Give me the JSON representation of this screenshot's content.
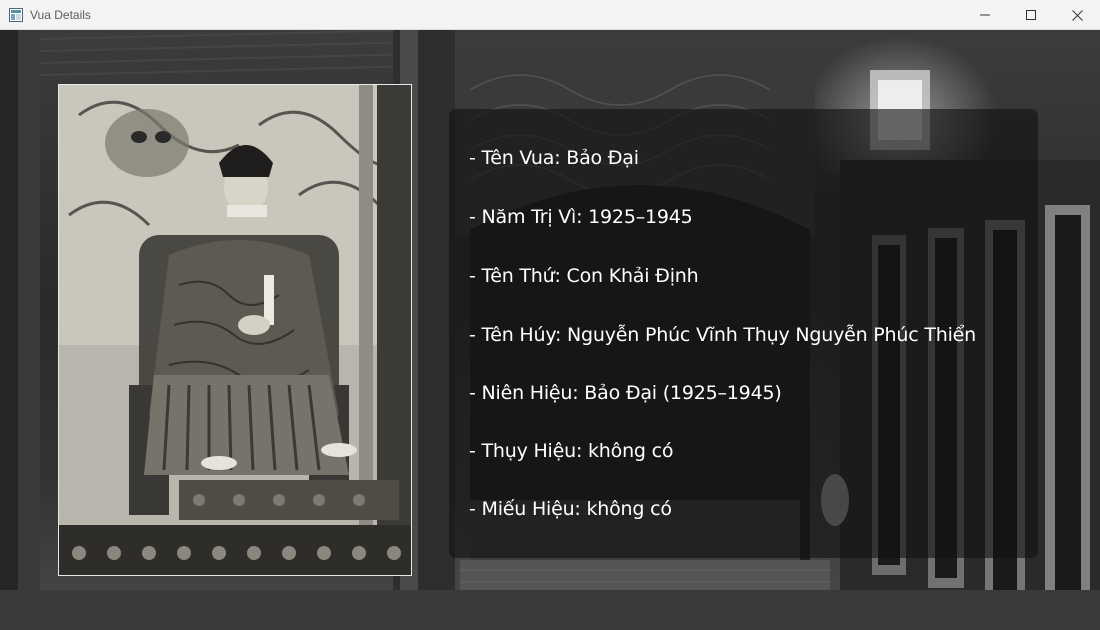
{
  "window": {
    "title": "Vua Details",
    "app_icon": "app-window-icon",
    "controls": [
      "minimize-icon",
      "maximize-icon",
      "close-icon"
    ]
  },
  "portrait": {
    "subject": "Emperor Bảo Đại seated on throne",
    "style": "black-and-white photograph"
  },
  "details": {
    "ten_vua": "- Tên Vua: Bảo Đại",
    "nam_tri_vi": "- Năm Trị Vì: 1925–1945",
    "ten_thu": "- Tên Thứ: Con Khải Định",
    "ten_huy": "- Tên Húy: Nguyễn Phúc Vĩnh Thụy Nguyễn Phúc Thiển",
    "nien_hieu": "- Niên Hiệu: Bảo Đại (1925–1945)",
    "thuy_hieu": "- Thụy Hiệu: không có",
    "mieu_hieu": "- Miếu Hiệu: không có"
  },
  "colors": {
    "panel_bg": "#121212",
    "text": "#ffffff",
    "titlebar_bg": "#f3f3f3"
  }
}
